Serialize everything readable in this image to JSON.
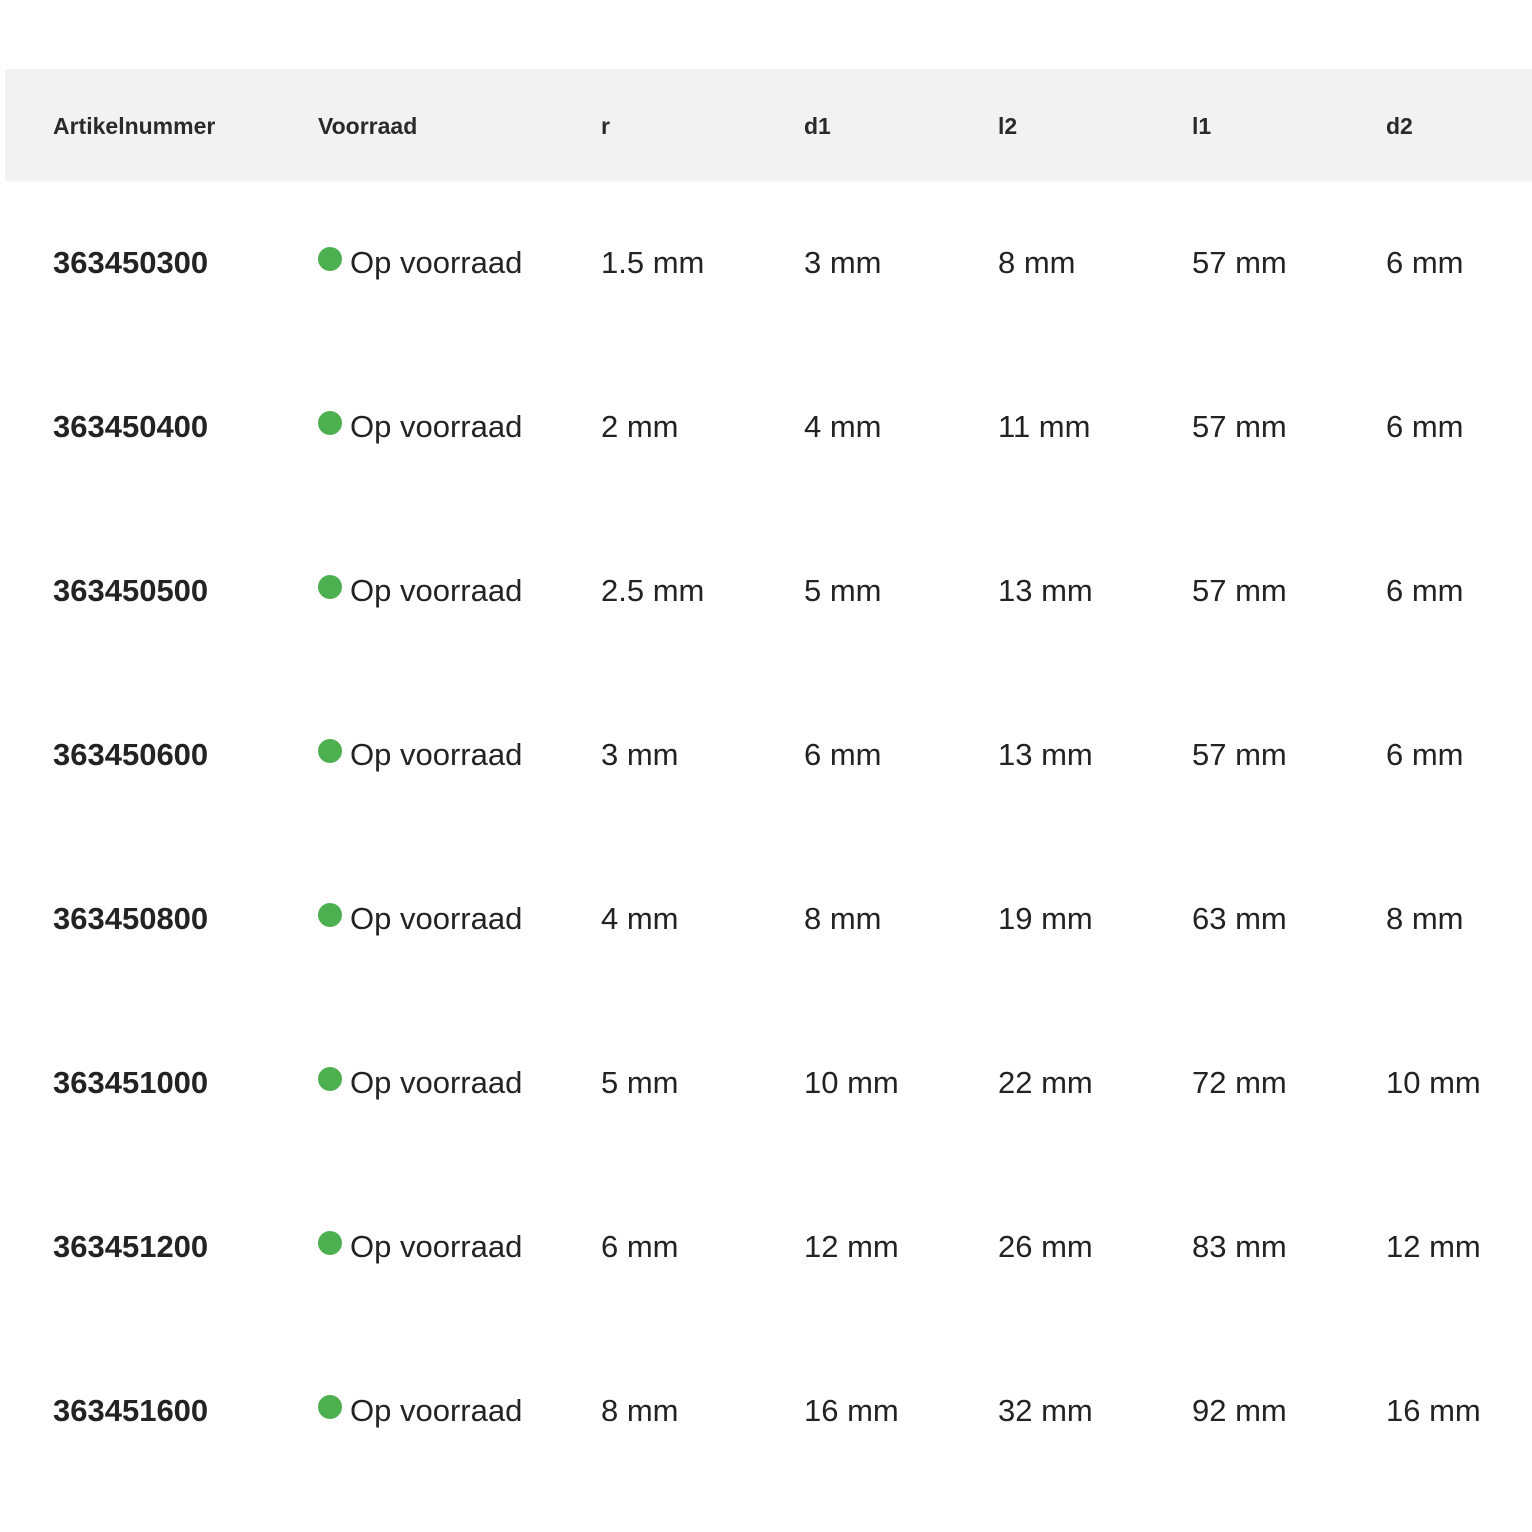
{
  "colors": {
    "header_bg": "#f2f2f2",
    "in_stock": "#4caf50",
    "text": "#232323"
  },
  "table": {
    "headers": [
      "Artikelnummer",
      "Voorraad",
      "r",
      "d1",
      "l2",
      "l1",
      "d2"
    ],
    "rows": [
      {
        "artikelnummer": "363450300",
        "voorraad": "Op voorraad",
        "r": "1.5 mm",
        "d1": "3 mm",
        "l2": "8 mm",
        "l1": "57 mm",
        "d2": "6 mm"
      },
      {
        "artikelnummer": "363450400",
        "voorraad": "Op voorraad",
        "r": "2 mm",
        "d1": "4 mm",
        "l2": "11 mm",
        "l1": "57 mm",
        "d2": "6 mm"
      },
      {
        "artikelnummer": "363450500",
        "voorraad": "Op voorraad",
        "r": "2.5 mm",
        "d1": "5 mm",
        "l2": "13 mm",
        "l1": "57 mm",
        "d2": "6 mm"
      },
      {
        "artikelnummer": "363450600",
        "voorraad": "Op voorraad",
        "r": "3 mm",
        "d1": "6 mm",
        "l2": "13 mm",
        "l1": "57 mm",
        "d2": "6 mm"
      },
      {
        "artikelnummer": "363450800",
        "voorraad": "Op voorraad",
        "r": "4 mm",
        "d1": "8 mm",
        "l2": "19 mm",
        "l1": "63 mm",
        "d2": "8 mm"
      },
      {
        "artikelnummer": "363451000",
        "voorraad": "Op voorraad",
        "r": "5 mm",
        "d1": "10 mm",
        "l2": "22 mm",
        "l1": "72 mm",
        "d2": "10 mm"
      },
      {
        "artikelnummer": "363451200",
        "voorraad": "Op voorraad",
        "r": "6 mm",
        "d1": "12 mm",
        "l2": "26 mm",
        "l1": "83 mm",
        "d2": "12 mm"
      },
      {
        "artikelnummer": "363451600",
        "voorraad": "Op voorraad",
        "r": "8 mm",
        "d1": "16 mm",
        "l2": "32 mm",
        "l1": "92 mm",
        "d2": "16 mm"
      }
    ]
  }
}
